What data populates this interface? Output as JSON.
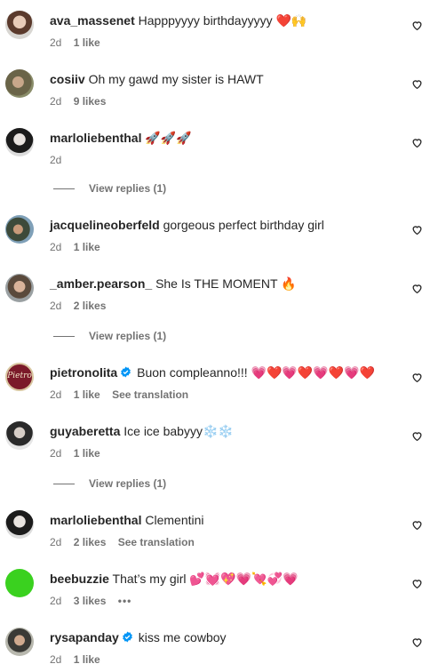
{
  "comments": [
    {
      "username": "ava_massenet",
      "text": "Happpyyyy birthdayyyyy ❤️🙌",
      "time": "2d",
      "likes": "1 like"
    },
    {
      "username": "cosiiv",
      "text": "Oh my gawd my sister is HAWT",
      "time": "2d",
      "likes": "9 likes"
    },
    {
      "username": "marloliebenthal",
      "text": "🚀🚀🚀",
      "time": "2d",
      "likes": ""
    },
    {
      "username": "jacquelineoberfeld",
      "text": "gorgeous perfect birthday girl",
      "time": "2d",
      "likes": "1 like"
    },
    {
      "username": "_amber.pearson_",
      "text": "She Is THE MOMENT 🔥",
      "time": "2d",
      "likes": "2 likes"
    },
    {
      "username": "pietronolita",
      "text": "Buon compleanno!!! 💗❤️💗❤️💗❤️💗❤️",
      "time": "2d",
      "likes": "1 like",
      "translate": "See translation",
      "verified": true,
      "avatar_text": "Pietro"
    },
    {
      "username": "guyaberetta",
      "text": "Ice ice babyyy❄️❄️",
      "time": "2d",
      "likes": "1 like"
    },
    {
      "username": "marloliebenthal",
      "text": "Clementini",
      "time": "2d",
      "likes": "2 likes",
      "translate": "See translation"
    },
    {
      "username": "beebuzzie",
      "text": "That’s my girl 💕💓💖💗💘💞💗",
      "time": "2d",
      "likes": "3 likes",
      "more": "•••"
    },
    {
      "username": "rysapanday",
      "text": "kiss me cowboy",
      "time": "2d",
      "likes": "1 like",
      "verified": true
    }
  ],
  "view_replies": [
    "View replies (1)",
    "View replies (1)",
    "View replies (1)"
  ],
  "colors": {
    "verified": "#0095f6",
    "muted": "#737373",
    "text": "#262626",
    "beebuzzie_avatar": "#3ad11f",
    "pietronolita_avatar": "#7b1a2a"
  }
}
